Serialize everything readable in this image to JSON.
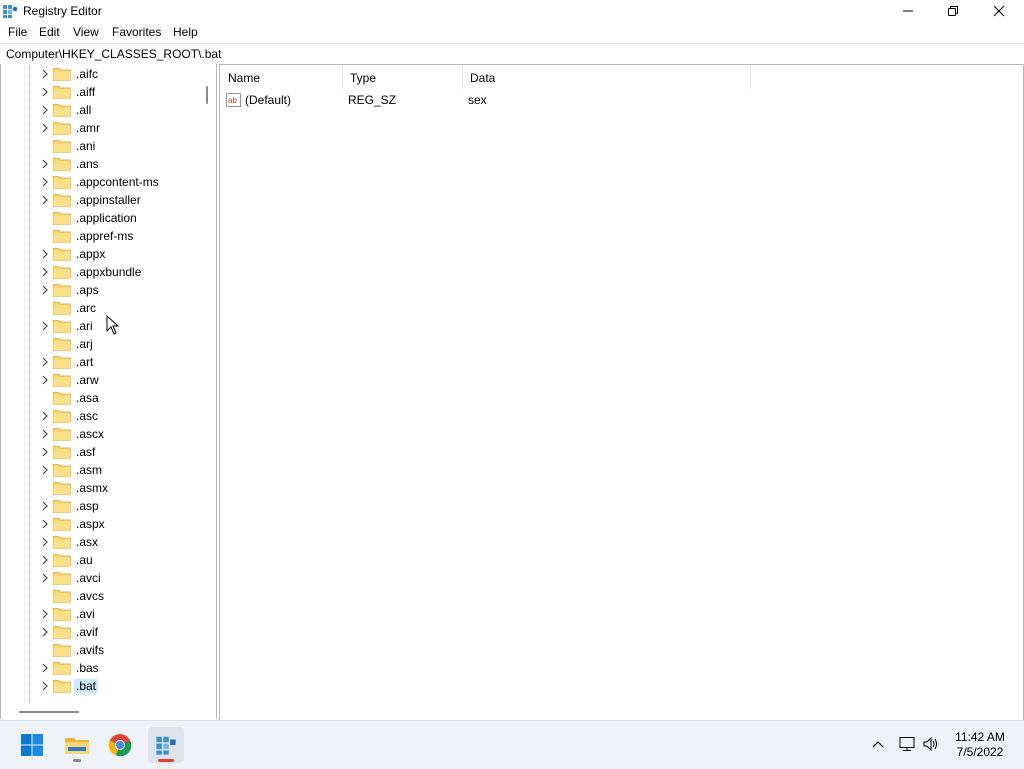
{
  "window": {
    "title": "Registry Editor",
    "icon": "registry-editor-icon"
  },
  "menu": [
    "File",
    "Edit",
    "View",
    "Favorites",
    "Help"
  ],
  "address": "Computer\\HKEY_CLASSES_ROOT\\.bat",
  "tree": {
    "items": [
      {
        "label": ".aifc",
        "expandable": true
      },
      {
        "label": ".aiff",
        "expandable": true
      },
      {
        "label": ".all",
        "expandable": true
      },
      {
        "label": ".amr",
        "expandable": true
      },
      {
        "label": ".ani",
        "expandable": false
      },
      {
        "label": ".ans",
        "expandable": true
      },
      {
        "label": ".appcontent-ms",
        "expandable": true
      },
      {
        "label": ".appinstaller",
        "expandable": true
      },
      {
        "label": ".application",
        "expandable": false
      },
      {
        "label": ".appref-ms",
        "expandable": false
      },
      {
        "label": ".appx",
        "expandable": true
      },
      {
        "label": ".appxbundle",
        "expandable": true
      },
      {
        "label": ".aps",
        "expandable": true
      },
      {
        "label": ".arc",
        "expandable": false
      },
      {
        "label": ".ari",
        "expandable": true
      },
      {
        "label": ".arj",
        "expandable": false
      },
      {
        "label": ".art",
        "expandable": true
      },
      {
        "label": ".arw",
        "expandable": true
      },
      {
        "label": ".asa",
        "expandable": false
      },
      {
        "label": ".asc",
        "expandable": true
      },
      {
        "label": ".ascx",
        "expandable": true
      },
      {
        "label": ".asf",
        "expandable": true
      },
      {
        "label": ".asm",
        "expandable": true
      },
      {
        "label": ".asmx",
        "expandable": false
      },
      {
        "label": ".asp",
        "expandable": true
      },
      {
        "label": ".aspx",
        "expandable": true
      },
      {
        "label": ".asx",
        "expandable": true
      },
      {
        "label": ".au",
        "expandable": true
      },
      {
        "label": ".avci",
        "expandable": true
      },
      {
        "label": ".avcs",
        "expandable": false
      },
      {
        "label": ".avi",
        "expandable": true
      },
      {
        "label": ".avif",
        "expandable": true
      },
      {
        "label": ".avifs",
        "expandable": false
      },
      {
        "label": ".bas",
        "expandable": true
      },
      {
        "label": ".bat",
        "expandable": true,
        "selected": true
      }
    ]
  },
  "values": {
    "columns": [
      "Name",
      "Type",
      "Data"
    ],
    "rows": [
      {
        "name": "(Default)",
        "type": "REG_SZ",
        "data": "sex",
        "icon": "string-value-icon"
      }
    ]
  },
  "taskbar": {
    "apps": [
      "start-icon",
      "file-explorer-icon",
      "chrome-icon",
      "registry-editor-icon"
    ],
    "time": "11:42 AM",
    "date": "7/5/2022"
  },
  "colors": {
    "selection": "#cce8ff",
    "folder": "#f8d775",
    "taskbar": "#eef1f5"
  }
}
